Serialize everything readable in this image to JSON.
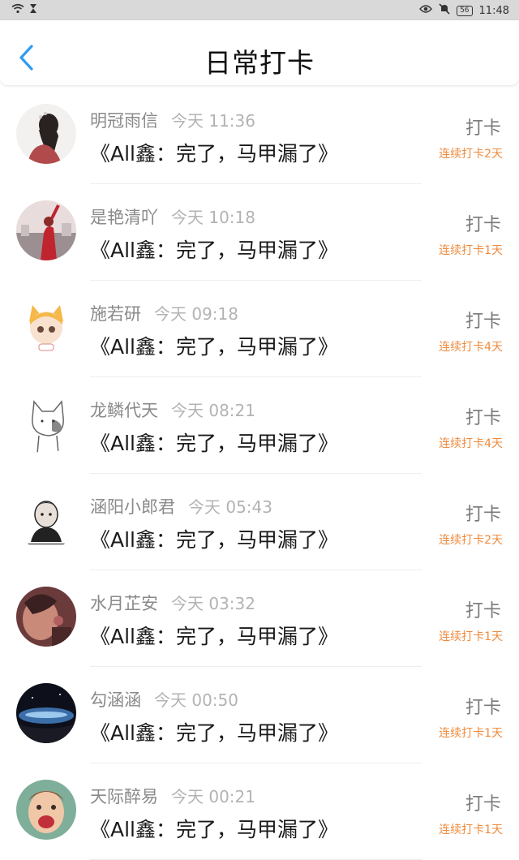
{
  "status_bar": {
    "time": "11:48",
    "battery": "56"
  },
  "header": {
    "title": "日常打卡"
  },
  "items": [
    {
      "name": "明冠雨信",
      "time": "今天 11:36",
      "message": "《All鑫：完了，马甲漏了》",
      "checkin_label": "打卡",
      "streak": "连续打卡2天"
    },
    {
      "name": "是艳清吖",
      "time": "今天 10:18",
      "message": "《All鑫：完了，马甲漏了》",
      "checkin_label": "打卡",
      "streak": "连续打卡1天"
    },
    {
      "name": "施若研",
      "time": "今天 09:18",
      "message": "《All鑫：完了，马甲漏了》",
      "checkin_label": "打卡",
      "streak": "连续打卡4天"
    },
    {
      "name": "龙鳞代天",
      "time": "今天 08:21",
      "message": "《All鑫：完了，马甲漏了》",
      "checkin_label": "打卡",
      "streak": "连续打卡4天"
    },
    {
      "name": "涵阳小郎君",
      "time": "今天 05:43",
      "message": "《All鑫：完了，马甲漏了》",
      "checkin_label": "打卡",
      "streak": "连续打卡2天"
    },
    {
      "name": "水月芷安",
      "time": "今天 03:32",
      "message": "《All鑫：完了，马甲漏了》",
      "checkin_label": "打卡",
      "streak": "连续打卡1天"
    },
    {
      "name": "勾涵涵",
      "time": "今天 00:50",
      "message": "《All鑫：完了，马甲漏了》",
      "checkin_label": "打卡",
      "streak": "连续打卡1天"
    },
    {
      "name": "天际醉易",
      "time": "今天 00:21",
      "message": "《All鑫：完了，马甲漏了》",
      "checkin_label": "打卡",
      "streak": "连续打卡1天"
    }
  ],
  "colors": {
    "accent": "#2e9cf0",
    "streak": "#f08a3c",
    "status_bar": "#d9d9d9"
  }
}
